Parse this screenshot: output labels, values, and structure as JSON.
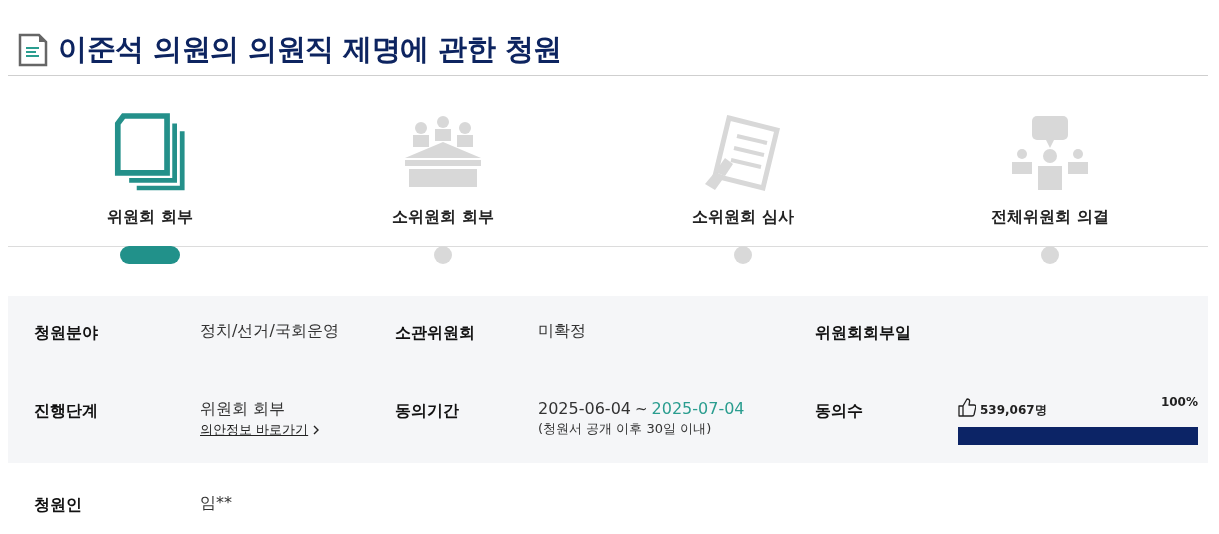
{
  "title": "이준석 의원의 의원직 제명에 관한 청원",
  "steps": [
    {
      "label": "위원회 회부",
      "kind": "documents",
      "selected": true
    },
    {
      "label": "소위원회 회부",
      "kind": "meeting",
      "selected": false
    },
    {
      "label": "소위원회 심사",
      "kind": "review",
      "selected": false
    },
    {
      "label": "전체위원회 의결",
      "kind": "discussion",
      "selected": false
    }
  ],
  "info_rows": [
    [
      {
        "kind": "text",
        "label": "청원분야",
        "value": "정치/선거/국회운영"
      },
      {
        "kind": "text",
        "label": "소관위원회",
        "value": "미확정"
      },
      {
        "kind": "text",
        "label": "위원회회부일"
      }
    ],
    [
      {
        "kind": "stage",
        "label": "진행단계",
        "value": "위원회 회부",
        "link": "의안정보 바로가기"
      },
      {
        "kind": "period",
        "label": "동의기간",
        "start": "2025-06-04",
        "separator": "~",
        "end": "2025-07-04",
        "note": "(청원서 공개 이후 30일 이내)"
      },
      {
        "kind": "agree",
        "label": "동의수",
        "count": "539,067명",
        "percent": "100%",
        "level": 1
      }
    ]
  ],
  "petitioner": {
    "label": "청원인",
    "value": "임**"
  }
}
